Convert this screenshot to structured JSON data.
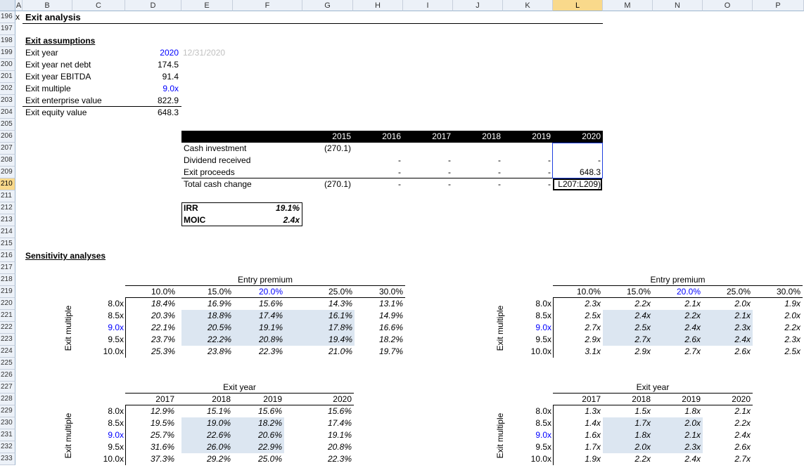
{
  "columns": [
    "A",
    "B",
    "C",
    "D",
    "E",
    "F",
    "G",
    "H",
    "I",
    "J",
    "K",
    "L",
    "M",
    "N",
    "O",
    "P"
  ],
  "selected_column": "L",
  "rows": [
    "196",
    "197",
    "198",
    "199",
    "200",
    "201",
    "202",
    "203",
    "204",
    "205",
    "206",
    "207",
    "208",
    "209",
    "210",
    "211",
    "212",
    "213",
    "214",
    "215",
    "216",
    "217",
    "218",
    "219",
    "220",
    "221",
    "222",
    "223",
    "224",
    "225",
    "226",
    "227",
    "228",
    "229",
    "230",
    "231",
    "232",
    "233"
  ],
  "selected_row": "210",
  "header": {
    "marker": "x",
    "title": "Exit analysis"
  },
  "assumptions": {
    "title": "Exit assumptions",
    "items": [
      {
        "label": "Exit year",
        "value": "2020",
        "extra": "12/31/2020"
      },
      {
        "label": "Exit year net debt",
        "value": "174.5"
      },
      {
        "label": "Exit year EBITDA",
        "value": "91.4"
      },
      {
        "label": "Exit multiple",
        "value": "9.0x"
      },
      {
        "label": "Exit enterprise value",
        "value": "822.9"
      },
      {
        "label": "Exit equity value",
        "value": "648.3"
      }
    ]
  },
  "cashflow": {
    "years": [
      "2015",
      "2016",
      "2017",
      "2018",
      "2019",
      "2020"
    ],
    "rows": [
      {
        "label": "Cash investment",
        "values": [
          "(270.1)",
          "",
          "",
          "",
          "",
          ""
        ]
      },
      {
        "label": "Dividend received",
        "values": [
          "",
          "-",
          "-",
          "-",
          "-",
          "-"
        ]
      },
      {
        "label": "Exit proceeds",
        "values": [
          "",
          "-",
          "-",
          "-",
          "-",
          "648.3"
        ]
      },
      {
        "label": "Total cash change",
        "values": [
          "(270.1)",
          "-",
          "-",
          "-",
          "-",
          "L207:L209)"
        ]
      }
    ]
  },
  "returns": {
    "irr_label": "IRR",
    "irr_value": "19.1%",
    "moic_label": "MOIC",
    "moic_value": "2.4x"
  },
  "sensitivity_title": "Sensitivity analyses",
  "tables": {
    "irr_premium": {
      "col_title": "Entry premium",
      "row_title": "Exit multiple",
      "cols": [
        "10.0%",
        "15.0%",
        "20.0%",
        "25.0%",
        "30.0%"
      ],
      "rows": [
        "8.0x",
        "8.5x",
        "9.0x",
        "9.5x",
        "10.0x"
      ],
      "cells": [
        [
          "18.4%",
          "16.9%",
          "15.6%",
          "14.3%",
          "13.1%"
        ],
        [
          "20.3%",
          "18.8%",
          "17.4%",
          "16.1%",
          "14.9%"
        ],
        [
          "22.1%",
          "20.5%",
          "19.1%",
          "17.8%",
          "16.6%"
        ],
        [
          "23.7%",
          "22.2%",
          "20.8%",
          "19.4%",
          "18.2%"
        ],
        [
          "25.3%",
          "23.8%",
          "22.3%",
          "21.0%",
          "19.7%"
        ]
      ]
    },
    "moic_premium": {
      "col_title": "Entry premium",
      "row_title": "Exit multiple",
      "cols": [
        "10.0%",
        "15.0%",
        "20.0%",
        "25.0%",
        "30.0%"
      ],
      "rows": [
        "8.0x",
        "8.5x",
        "9.0x",
        "9.5x",
        "10.0x"
      ],
      "cells": [
        [
          "2.3x",
          "2.2x",
          "2.1x",
          "2.0x",
          "1.9x"
        ],
        [
          "2.5x",
          "2.4x",
          "2.2x",
          "2.1x",
          "2.0x"
        ],
        [
          "2.7x",
          "2.5x",
          "2.4x",
          "2.3x",
          "2.2x"
        ],
        [
          "2.9x",
          "2.7x",
          "2.6x",
          "2.4x",
          "2.3x"
        ],
        [
          "3.1x",
          "2.9x",
          "2.7x",
          "2.6x",
          "2.5x"
        ]
      ]
    },
    "irr_year": {
      "col_title": "Exit year",
      "row_title": "Exit multiple",
      "cols": [
        "2017",
        "2018",
        "2019",
        "2020"
      ],
      "rows": [
        "8.0x",
        "8.5x",
        "9.0x",
        "9.5x",
        "10.0x"
      ],
      "cells": [
        [
          "12.9%",
          "15.1%",
          "15.6%",
          "15.6%"
        ],
        [
          "19.5%",
          "19.0%",
          "18.2%",
          "17.4%"
        ],
        [
          "25.7%",
          "22.6%",
          "20.6%",
          "19.1%"
        ],
        [
          "31.6%",
          "26.0%",
          "22.9%",
          "20.8%"
        ],
        [
          "37.3%",
          "29.2%",
          "25.0%",
          "22.3%"
        ]
      ]
    },
    "moic_year": {
      "col_title": "Exit year",
      "row_title": "Exit multiple",
      "cols": [
        "2017",
        "2018",
        "2019",
        "2020"
      ],
      "rows": [
        "8.0x",
        "8.5x",
        "9.0x",
        "9.5x",
        "10.0x"
      ],
      "cells": [
        [
          "1.3x",
          "1.5x",
          "1.8x",
          "2.1x"
        ],
        [
          "1.4x",
          "1.7x",
          "2.0x",
          "2.2x"
        ],
        [
          "1.6x",
          "1.8x",
          "2.1x",
          "2.4x"
        ],
        [
          "1.7x",
          "2.0x",
          "2.3x",
          "2.6x"
        ],
        [
          "1.9x",
          "2.2x",
          "2.4x",
          "2.7x"
        ]
      ]
    }
  },
  "colors": {
    "input_blue": "#0000ff",
    "highlight": "#dce6f1",
    "selection": "#f9d98b",
    "active_border": "#1f3fdf"
  }
}
